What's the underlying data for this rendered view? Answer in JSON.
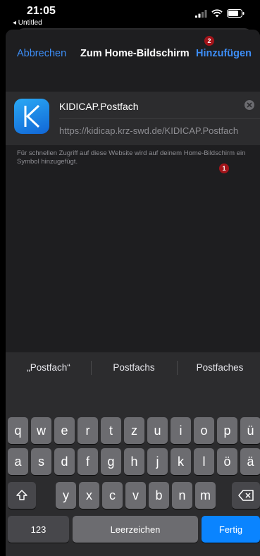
{
  "status": {
    "time": "21:05",
    "back_label": "◂ Untitled"
  },
  "nav": {
    "cancel_label": "Abbrechen",
    "title": "Zum Home-Bildschirm",
    "add_label": "Hinzufügen",
    "add_badge": "2"
  },
  "bookmark": {
    "icon_letter": "K",
    "name": "KIDICAP.Postfach",
    "name_badge": "1",
    "url": "https://kidicap.krz-swd.de/KIDICAP.Postfach"
  },
  "footnote": "Für schnellen Zugriff auf diese Website wird auf deinem Home-Bildschirm ein Symbol hinzugefügt.",
  "keyboard": {
    "suggestions": [
      "„Postfach“",
      "Postfachs",
      "Postfaches"
    ],
    "row1": [
      "q",
      "w",
      "e",
      "r",
      "t",
      "z",
      "u",
      "i",
      "o",
      "p",
      "ü"
    ],
    "row2": [
      "a",
      "s",
      "d",
      "f",
      "g",
      "h",
      "j",
      "k",
      "l",
      "ö",
      "ä"
    ],
    "row3": [
      "y",
      "x",
      "c",
      "v",
      "b",
      "n",
      "m"
    ],
    "numbers_label": "123",
    "space_label": "Leerzeichen",
    "done_label": "Fertig"
  },
  "colors": {
    "accent": "#3d8ef7",
    "badge": "#a3141a",
    "done_key": "#0a84ff"
  }
}
